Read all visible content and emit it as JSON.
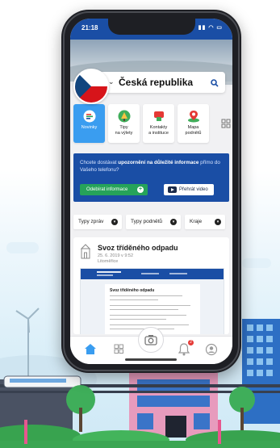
{
  "status": {
    "time": "21:18",
    "icons": "▮▮ ◠ ▭"
  },
  "search": {
    "region": "Česká republika"
  },
  "tiles": [
    {
      "label": "Novinky"
    },
    {
      "label": "Tipy\nna výlety"
    },
    {
      "label": "Kontakty\na instituce"
    },
    {
      "label": "Mapa\npodnětů"
    }
  ],
  "banner": {
    "text_pre": "Chcete dostávat ",
    "text_bold": "upozornění na důležité informace",
    "text_post": " přímo do Vašeho telefonu?",
    "subscribe_label": "Odebírat informace",
    "video_label": "Přehrát video"
  },
  "filters": [
    {
      "label": "Typy zpráv"
    },
    {
      "label": "Typy podnětů"
    },
    {
      "label": "Kraje"
    }
  ],
  "news": {
    "title": "Svoz tříděného odpadu",
    "date": "25. 6. 2019 v 9:52",
    "source": "Litoměřice",
    "doc_title": "Svoz tříděného odpadu"
  },
  "tabbar": {
    "notifications_count": "2"
  },
  "colors": {
    "primary": "#1a4ea5",
    "accent": "#3a9df0",
    "green": "#26a35a",
    "badge": "#e53935"
  }
}
